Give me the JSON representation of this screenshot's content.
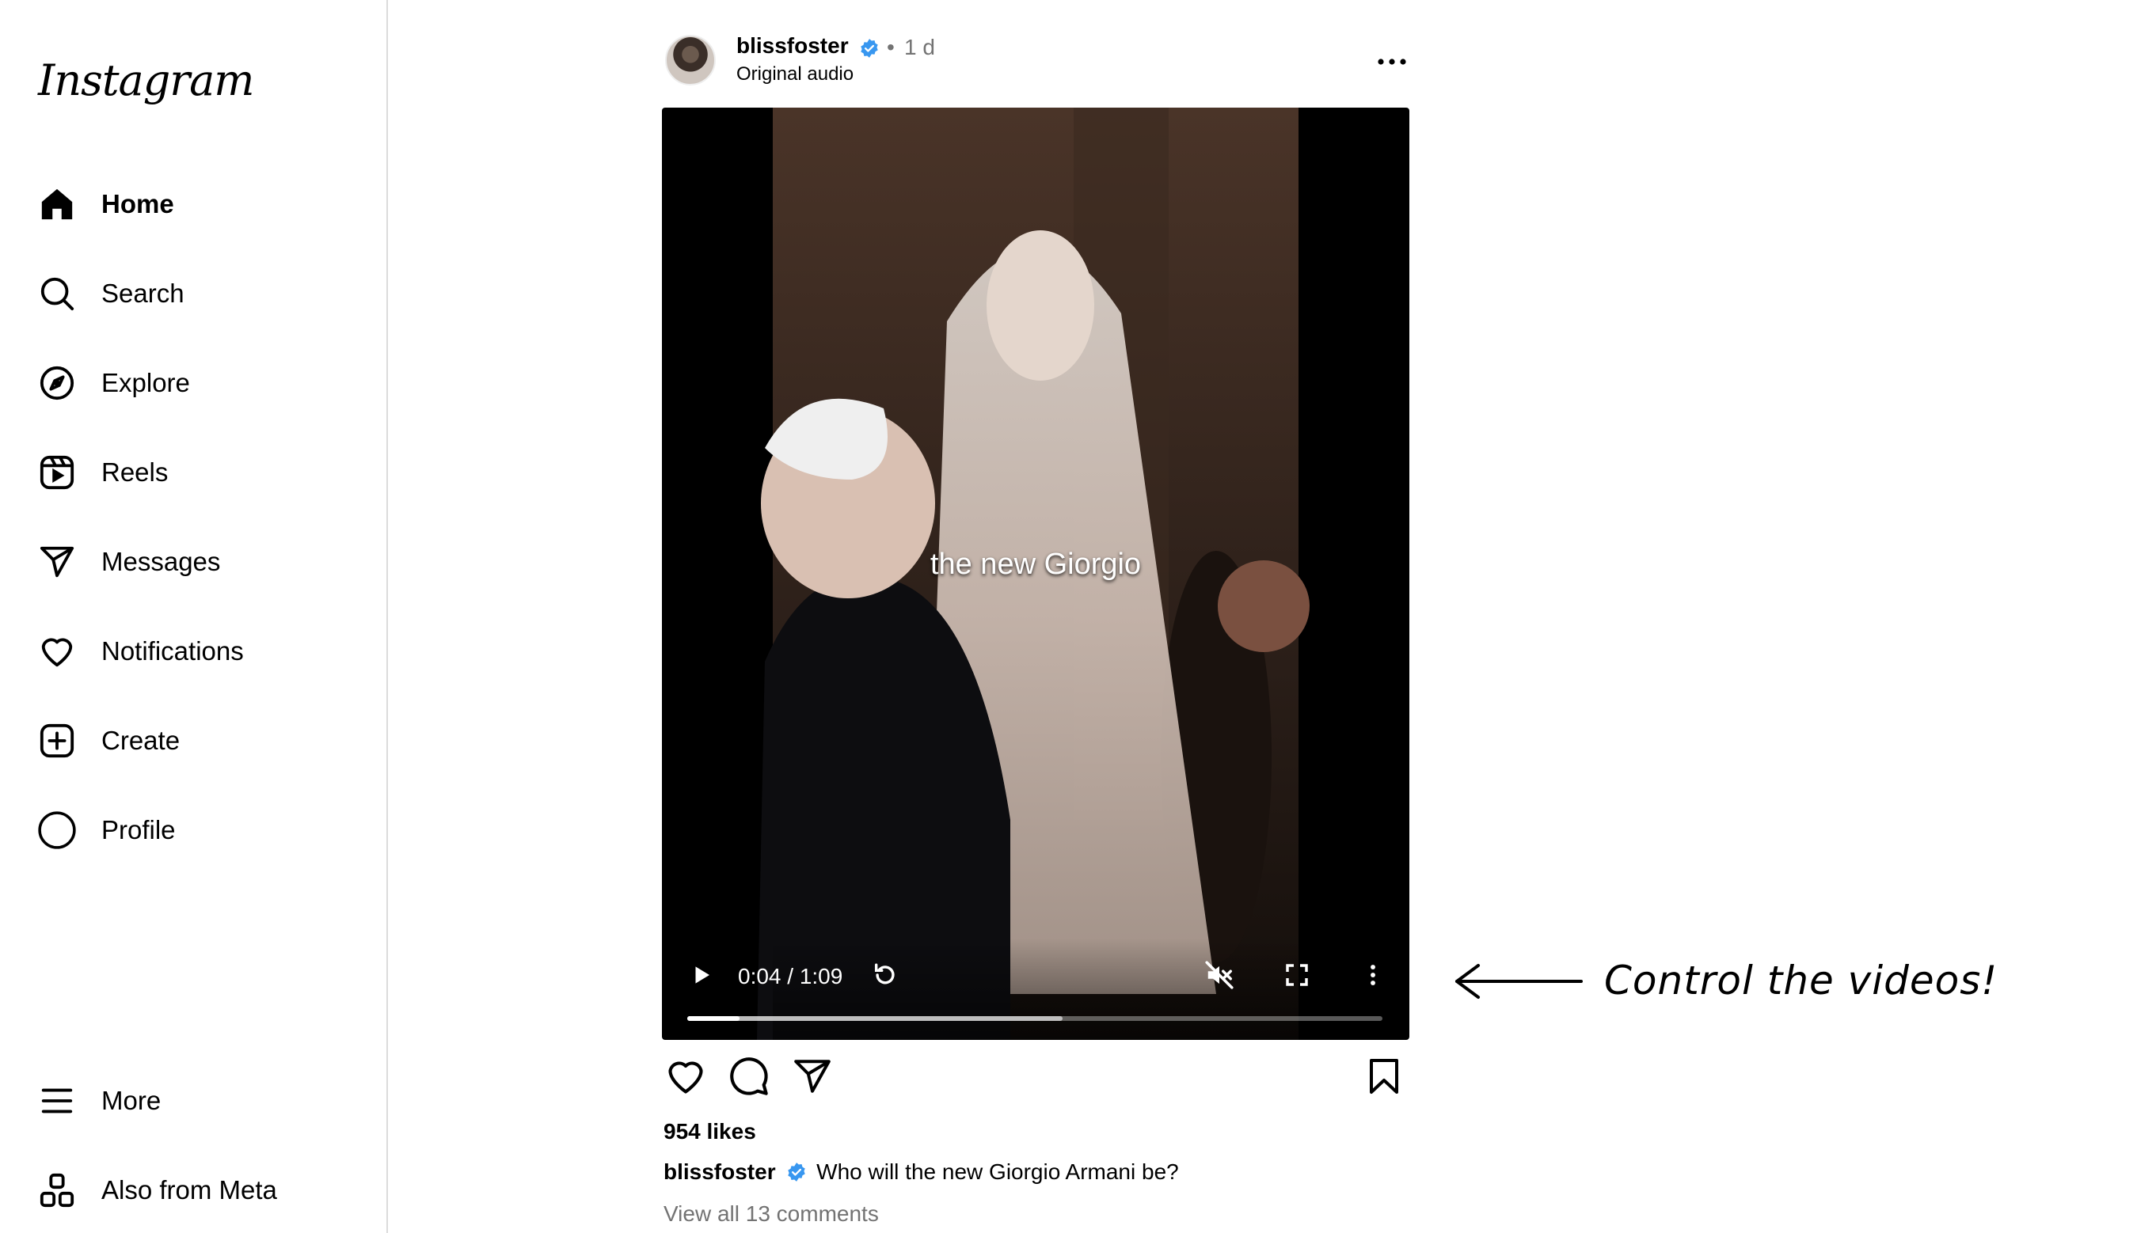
{
  "sidebar": {
    "logo": "Instagram",
    "items": [
      {
        "label": "Home",
        "icon": "home-icon"
      },
      {
        "label": "Search",
        "icon": "search-icon"
      },
      {
        "label": "Explore",
        "icon": "compass-icon"
      },
      {
        "label": "Reels",
        "icon": "reels-icon"
      },
      {
        "label": "Messages",
        "icon": "send-icon"
      },
      {
        "label": "Notifications",
        "icon": "heart-icon"
      },
      {
        "label": "Create",
        "icon": "plus-square-icon"
      },
      {
        "label": "Profile",
        "icon": "profile-circle-icon"
      }
    ],
    "bottom_items": [
      {
        "label": "More",
        "icon": "menu-icon"
      },
      {
        "label": "Also from Meta",
        "icon": "meta-apps-icon"
      }
    ]
  },
  "post": {
    "username": "blissfoster",
    "separator": "•",
    "time_ago": "1 d",
    "audio": "Original audio",
    "video": {
      "overlay_text": "the new Giorgio",
      "time_display": "0:04 / 1:09",
      "progress_played": 0.075,
      "progress_buffered": 0.54
    },
    "likes": "954 likes",
    "caption_user": "blissfoster",
    "caption_text": "Who will the new Giorgio Armani be?",
    "comments_link": "View all 13 comments"
  },
  "annotation": {
    "text": "Control the videos!"
  },
  "colors": {
    "verified": "#3897f0",
    "muted_text": "#737373",
    "divider": "#dbdbdb"
  }
}
